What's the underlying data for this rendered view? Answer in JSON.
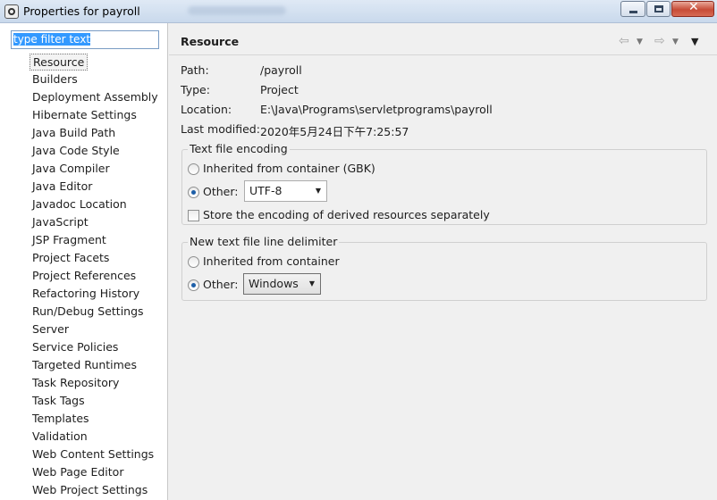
{
  "window": {
    "title": "Properties for payroll",
    "blurred_text": "………………"
  },
  "filter": {
    "value": "type filter text"
  },
  "tree": [
    "Resource",
    "Builders",
    "Deployment Assembly",
    "Hibernate Settings",
    "Java Build Path",
    "Java Code Style",
    "Java Compiler",
    "Java Editor",
    "Javadoc Location",
    "JavaScript",
    "JSP Fragment",
    "Project Facets",
    "Project References",
    "Refactoring History",
    "Run/Debug Settings",
    "Server",
    "Service Policies",
    "Targeted Runtimes",
    "Task Repository",
    "Task Tags",
    "Templates",
    "Validation",
    "Web Content Settings",
    "Web Page Editor",
    "Web Project Settings"
  ],
  "selected_item": "Resource",
  "page": {
    "title": "Resource",
    "path_label": "Path:",
    "path_value": "/payroll",
    "type_label": "Type:",
    "type_value": "Project",
    "location_label": "Location:",
    "location_value": "E:\\Java\\Programs\\servletprograms\\payroll",
    "modified_label": "Last modified:",
    "modified_value": "2020年5月24日下午7:25:57"
  },
  "encoding": {
    "title": "Text file encoding",
    "inherited_label": "Inherited from container (GBK)",
    "other_label": "Other:",
    "other_value": "UTF-8",
    "store_label": "Store the encoding of derived resources separately"
  },
  "delimiter": {
    "title": "New text file line delimiter",
    "inherited_label": "Inherited from container",
    "other_label": "Other:",
    "other_value": "Windows"
  },
  "icons": {
    "back": "⇦",
    "forward": "⇨",
    "dropdown": "▼",
    "close": "✕"
  }
}
